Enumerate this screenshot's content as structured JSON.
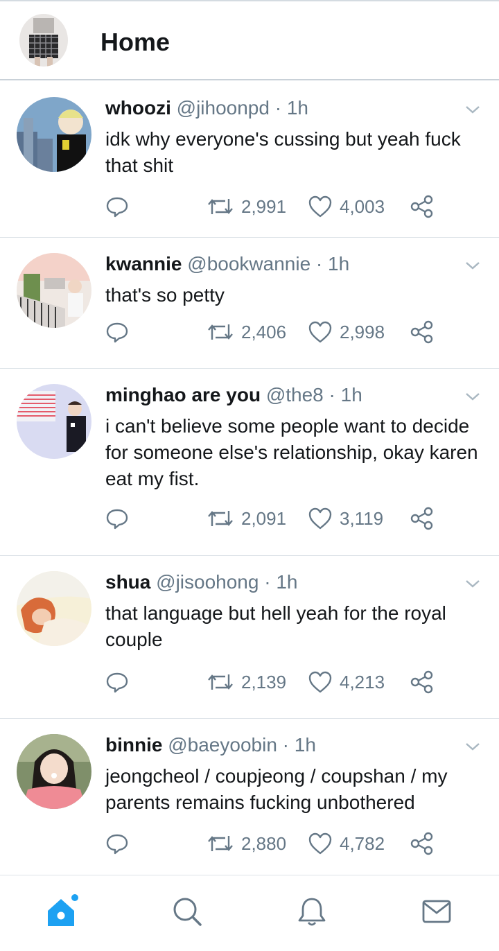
{
  "header": {
    "title": "Home",
    "profile_avatar_icon": "profile-avatar-icon"
  },
  "tweets": [
    {
      "name": "whoozi",
      "handle": "@jihoonpd",
      "separator": "·",
      "time": "1h",
      "text": "idk why everyone's cussing but yeah fuck that shit",
      "retweets": "2,991",
      "likes": "4,003"
    },
    {
      "name": "kwannie",
      "handle": "@bookwannie",
      "separator": "·",
      "time": "1h",
      "text": "that's so petty",
      "retweets": "2,406",
      "likes": "2,998"
    },
    {
      "name": "minghao are you",
      "handle": "@the8",
      "separator": "·",
      "time": "1h",
      "text": "i can't believe some people want to decide for someone else's relationship, okay karen eat my fist.",
      "retweets": "2,091",
      "likes": "3,119"
    },
    {
      "name": "shua",
      "handle": "@jisoohong",
      "separator": "·",
      "time": "1h",
      "text": "that language but hell yeah for the royal couple",
      "retweets": "2,139",
      "likes": "4,213"
    },
    {
      "name": "binnie",
      "handle": "@baeyoobin",
      "separator": "·",
      "time": "1h",
      "text": "jeongcheol / coupjeong / coupshan / my parents remains fucking unbothered",
      "retweets": "2,880",
      "likes": "4,782"
    }
  ],
  "icons": {
    "reply": "reply-icon",
    "retweet": "retweet-icon",
    "like": "heart-icon",
    "share": "share-icon",
    "caret": "chevron-down-icon"
  },
  "bottom_nav": {
    "items": [
      "home-icon",
      "search-icon",
      "notifications-icon",
      "messages-icon"
    ],
    "active": "home-icon"
  },
  "colors": {
    "accent": "#1da1f2",
    "text": "#14171a",
    "muted": "#657786",
    "divider": "#dde3e8"
  }
}
